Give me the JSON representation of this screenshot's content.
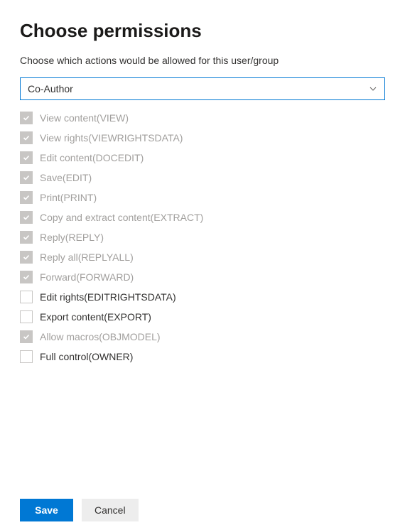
{
  "header": {
    "title": "Choose permissions",
    "subtitle": "Choose which actions would be allowed for this user/group"
  },
  "dropdown": {
    "selected": "Co-Author"
  },
  "permissions": [
    {
      "label": "View content(VIEW)",
      "checked": true,
      "disabled": true
    },
    {
      "label": "View rights(VIEWRIGHTSDATA)",
      "checked": true,
      "disabled": true
    },
    {
      "label": "Edit content(DOCEDIT)",
      "checked": true,
      "disabled": true
    },
    {
      "label": "Save(EDIT)",
      "checked": true,
      "disabled": true
    },
    {
      "label": "Print(PRINT)",
      "checked": true,
      "disabled": true
    },
    {
      "label": "Copy and extract content(EXTRACT)",
      "checked": true,
      "disabled": true
    },
    {
      "label": "Reply(REPLY)",
      "checked": true,
      "disabled": true
    },
    {
      "label": "Reply all(REPLYALL)",
      "checked": true,
      "disabled": true
    },
    {
      "label": "Forward(FORWARD)",
      "checked": true,
      "disabled": true
    },
    {
      "label": "Edit rights(EDITRIGHTSDATA)",
      "checked": false,
      "disabled": false
    },
    {
      "label": "Export content(EXPORT)",
      "checked": false,
      "disabled": false
    },
    {
      "label": "Allow macros(OBJMODEL)",
      "checked": true,
      "disabled": true
    },
    {
      "label": "Full control(OWNER)",
      "checked": false,
      "disabled": false
    }
  ],
  "footer": {
    "save_label": "Save",
    "cancel_label": "Cancel"
  }
}
